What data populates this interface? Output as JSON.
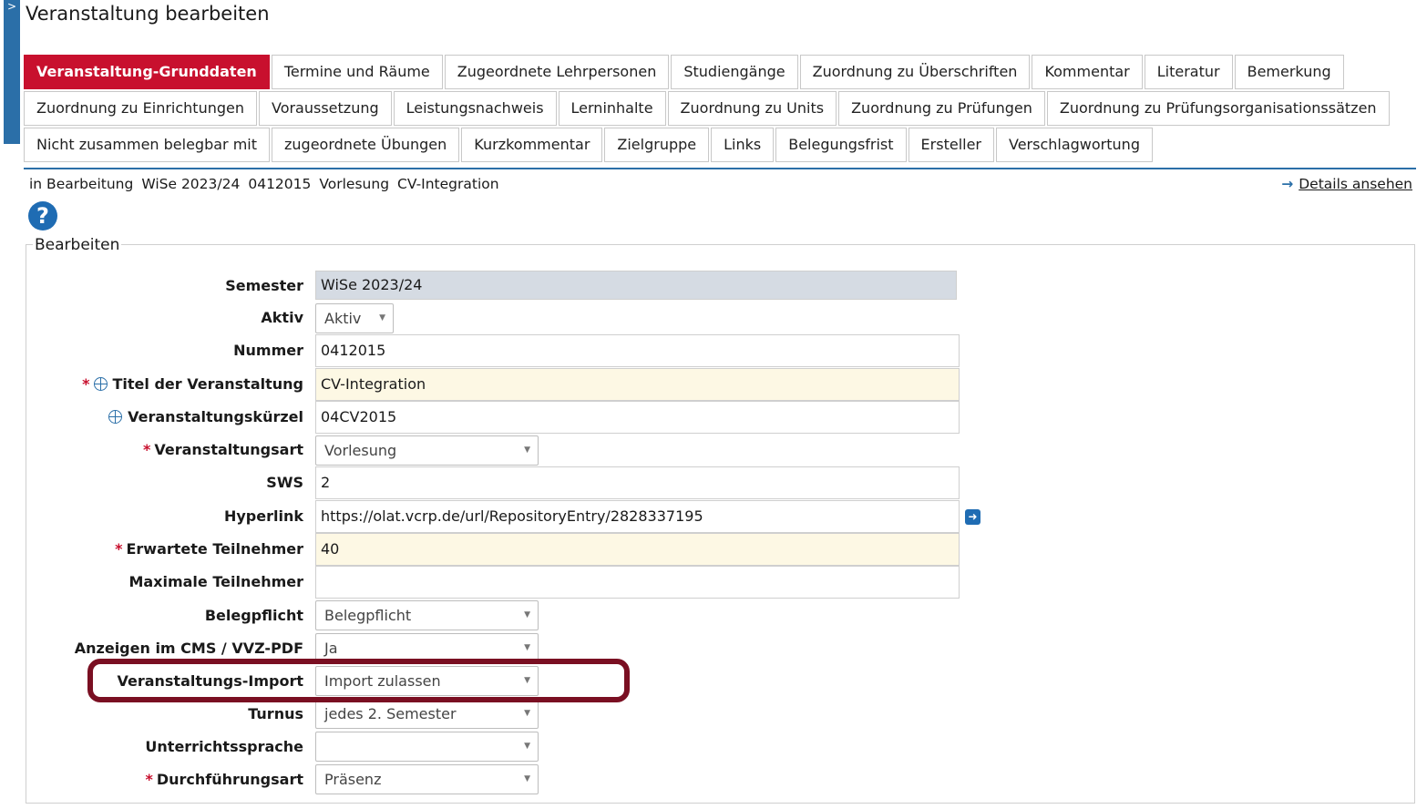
{
  "sidebar": {
    "toggle_label": ">"
  },
  "page_title": "Veranstaltung bearbeiten",
  "tabs": {
    "row1": [
      {
        "label": "Veranstaltung-Grunddaten",
        "active": true
      },
      {
        "label": "Termine und Räume"
      },
      {
        "label": "Zugeordnete Lehrpersonen"
      },
      {
        "label": "Studiengänge"
      },
      {
        "label": "Zuordnung zu Überschriften"
      },
      {
        "label": "Kommentar"
      },
      {
        "label": "Literatur"
      },
      {
        "label": "Bemerkung"
      }
    ],
    "row2": [
      {
        "label": "Zuordnung zu Einrichtungen"
      },
      {
        "label": "Voraussetzung"
      },
      {
        "label": "Leistungsnachweis"
      },
      {
        "label": "Lerninhalte"
      },
      {
        "label": "Zuordnung zu Units"
      },
      {
        "label": "Zuordnung zu Prüfungen"
      },
      {
        "label": "Zuordnung zu Prüfungsorganisationssätzen"
      }
    ],
    "row3": [
      {
        "label": "Nicht zusammen belegbar mit"
      },
      {
        "label": "zugeordnete Übungen"
      },
      {
        "label": "Kurzkommentar"
      },
      {
        "label": "Zielgruppe"
      },
      {
        "label": "Links"
      },
      {
        "label": "Belegungsfrist"
      },
      {
        "label": "Ersteller"
      },
      {
        "label": "Verschlagwortung"
      }
    ]
  },
  "status": {
    "state": "in Bearbeitung",
    "semester": "WiSe 2023/24",
    "number": "0412015",
    "type": "Vorlesung",
    "title": "CV-Integration",
    "details_link": "Details ansehen"
  },
  "help": {
    "symbol": "?"
  },
  "form": {
    "legend": "Bearbeiten",
    "semester": {
      "label": "Semester",
      "value": "WiSe 2023/24"
    },
    "aktiv": {
      "label": "Aktiv",
      "value": "Aktiv"
    },
    "nummer": {
      "label": "Nummer",
      "value": "0412015"
    },
    "titel": {
      "label": "Titel der Veranstaltung",
      "value": "CV-Integration",
      "required": "*"
    },
    "kuerzel": {
      "label": "Veranstaltungskürzel",
      "value": "04CV2015"
    },
    "art": {
      "label": "Veranstaltungsart",
      "value": "Vorlesung",
      "required": "*"
    },
    "sws": {
      "label": "SWS",
      "value": "2"
    },
    "hyperlink": {
      "label": "Hyperlink",
      "value": "https://olat.vcrp.de/url/RepositoryEntry/2828337195"
    },
    "erwartete": {
      "label": "Erwartete Teilnehmer",
      "value": "40",
      "required": "*"
    },
    "maximale": {
      "label": "Maximale Teilnehmer",
      "value": ""
    },
    "belegpflicht": {
      "label": "Belegpflicht",
      "value": "Belegpflicht"
    },
    "anzeigen": {
      "label": "Anzeigen im CMS / VVZ-PDF",
      "value": "Ja"
    },
    "import": {
      "label": "Veranstaltungs-Import",
      "value": "Import zulassen"
    },
    "turnus": {
      "label": "Turnus",
      "value": "jedes 2. Semester"
    },
    "sprache": {
      "label": "Unterrichtssprache",
      "value": ""
    },
    "durchfuehrung": {
      "label": "Durchführungsart",
      "value": "Präsenz",
      "required": "*"
    }
  },
  "colors": {
    "accent": "#2b6fa8",
    "active_tab": "#c8102e",
    "highlight": "#7a0f22",
    "required_bg": "#fdf8e4",
    "readonly_bg": "#d5dbe3"
  }
}
